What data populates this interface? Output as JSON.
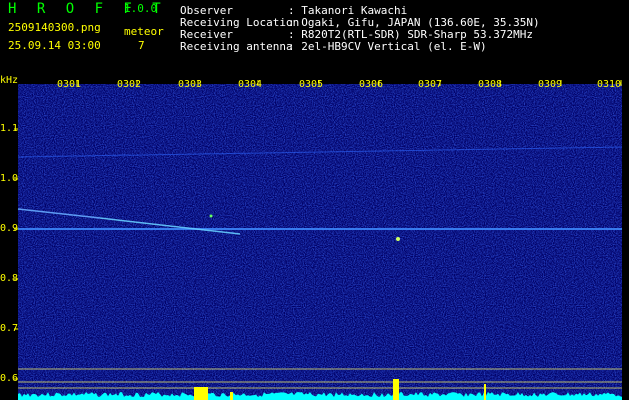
{
  "header": {
    "app_title": "H R O F F T",
    "app_version": "1.0.0",
    "filename": "2509140300.png",
    "datetime": "25.09.14 03:00",
    "meteor_label": "meteor",
    "meteor_count": "7",
    "info": [
      {
        "label": "Observer",
        "value": ": Takanori Kawachi"
      },
      {
        "label": "Receiving Location",
        "value": ": Ogaki, Gifu, JAPAN (136.60E, 35.35N)"
      },
      {
        "label": "Receiver",
        "value": ": R820T2(RTL-SDR) SDR-Sharp 53.372MHz"
      },
      {
        "label": "Receiving antenna",
        "value": ": 2el-HB9CV Vertical (el. E-W)"
      }
    ]
  },
  "spectrogram": {
    "y_unit": "kHz",
    "y_ticks": [
      "1.1",
      "1.0",
      "0.9",
      "0.8",
      "0.7",
      "0.6"
    ],
    "x_ticks": [
      "0301",
      "0302",
      "0303",
      "0304",
      "0305",
      "0306",
      "0307",
      "0308",
      "0309",
      "0310"
    ],
    "colors": {
      "background": "#000066",
      "noise": "#1a3cff",
      "signal": "#66ccff",
      "grid": "#ffff00",
      "level": "#00ffff"
    }
  }
}
